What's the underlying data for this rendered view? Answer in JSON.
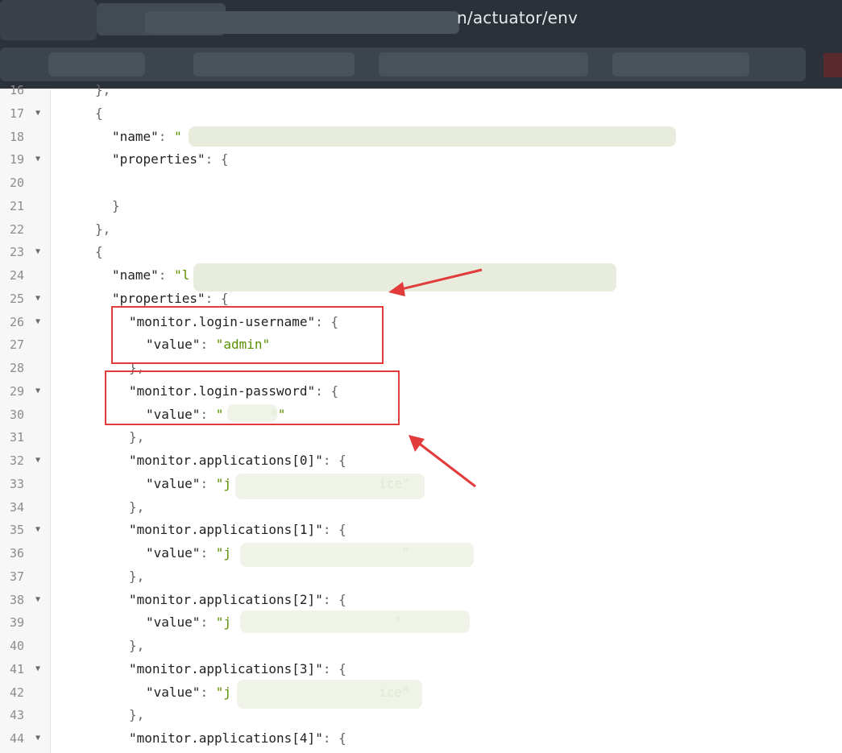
{
  "browser": {
    "url_visible": "n/actuator/env"
  },
  "editor": {
    "lines": [
      {
        "n": "16",
        "fold": false,
        "indent": 1,
        "parts": [
          {
            "t": "p",
            "v": "},"
          }
        ]
      },
      {
        "n": "17",
        "fold": true,
        "indent": 1,
        "parts": [
          {
            "t": "p",
            "v": "{"
          }
        ]
      },
      {
        "n": "18",
        "fold": false,
        "indent": 2,
        "parts": [
          {
            "t": "k",
            "v": "\"name\""
          },
          {
            "t": "p",
            "v": ": "
          },
          {
            "t": "s",
            "v": "\""
          }
        ]
      },
      {
        "n": "19",
        "fold": true,
        "indent": 2,
        "parts": [
          {
            "t": "k",
            "v": "\"properties\""
          },
          {
            "t": "p",
            "v": ": {"
          }
        ]
      },
      {
        "n": "20",
        "fold": false,
        "indent": 2,
        "parts": []
      },
      {
        "n": "21",
        "fold": false,
        "indent": 2,
        "parts": [
          {
            "t": "p",
            "v": "}"
          }
        ]
      },
      {
        "n": "22",
        "fold": false,
        "indent": 1,
        "parts": [
          {
            "t": "p",
            "v": "},"
          }
        ]
      },
      {
        "n": "23",
        "fold": true,
        "indent": 1,
        "parts": [
          {
            "t": "p",
            "v": "{"
          }
        ]
      },
      {
        "n": "24",
        "fold": false,
        "indent": 2,
        "parts": [
          {
            "t": "k",
            "v": "\"name\""
          },
          {
            "t": "p",
            "v": ": "
          },
          {
            "t": "s",
            "v": "\"l"
          }
        ]
      },
      {
        "n": "25",
        "fold": true,
        "indent": 2,
        "parts": [
          {
            "t": "k",
            "v": "\"properties\""
          },
          {
            "t": "p",
            "v": ": {"
          }
        ]
      },
      {
        "n": "26",
        "fold": true,
        "indent": 3,
        "parts": [
          {
            "t": "k",
            "v": "\"monitor.login-username\""
          },
          {
            "t": "p",
            "v": ": {"
          }
        ]
      },
      {
        "n": "27",
        "fold": false,
        "indent": 4,
        "parts": [
          {
            "t": "k",
            "v": "\"value\""
          },
          {
            "t": "p",
            "v": ": "
          },
          {
            "t": "s",
            "v": "\"admin\""
          }
        ]
      },
      {
        "n": "28",
        "fold": false,
        "indent": 3,
        "parts": [
          {
            "t": "p",
            "v": "},"
          }
        ]
      },
      {
        "n": "29",
        "fold": true,
        "indent": 3,
        "parts": [
          {
            "t": "k",
            "v": "\"monitor.login-password\""
          },
          {
            "t": "p",
            "v": ": {"
          }
        ]
      },
      {
        "n": "30",
        "fold": false,
        "indent": 4,
        "parts": [
          {
            "t": "k",
            "v": "\"value\""
          },
          {
            "t": "p",
            "v": ": "
          },
          {
            "t": "s",
            "v": "\"      *\""
          }
        ]
      },
      {
        "n": "31",
        "fold": false,
        "indent": 3,
        "parts": [
          {
            "t": "p",
            "v": "},"
          }
        ]
      },
      {
        "n": "32",
        "fold": true,
        "indent": 3,
        "parts": [
          {
            "t": "k",
            "v": "\"monitor.applications[0]\""
          },
          {
            "t": "p",
            "v": ": {"
          }
        ]
      },
      {
        "n": "33",
        "fold": false,
        "indent": 4,
        "parts": [
          {
            "t": "k",
            "v": "\"value\""
          },
          {
            "t": "p",
            "v": ": "
          },
          {
            "t": "s",
            "v": "\"j                   ice\""
          }
        ]
      },
      {
        "n": "34",
        "fold": false,
        "indent": 3,
        "parts": [
          {
            "t": "p",
            "v": "},"
          }
        ]
      },
      {
        "n": "35",
        "fold": true,
        "indent": 3,
        "parts": [
          {
            "t": "k",
            "v": "\"monitor.applications[1]\""
          },
          {
            "t": "p",
            "v": ": {"
          }
        ]
      },
      {
        "n": "36",
        "fold": false,
        "indent": 4,
        "parts": [
          {
            "t": "k",
            "v": "\"value\""
          },
          {
            "t": "p",
            "v": ": "
          },
          {
            "t": "s",
            "v": "\"j                      \""
          }
        ]
      },
      {
        "n": "37",
        "fold": false,
        "indent": 3,
        "parts": [
          {
            "t": "p",
            "v": "},"
          }
        ]
      },
      {
        "n": "38",
        "fold": true,
        "indent": 3,
        "parts": [
          {
            "t": "k",
            "v": "\"monitor.applications[2]\""
          },
          {
            "t": "p",
            "v": ": {"
          }
        ]
      },
      {
        "n": "39",
        "fold": false,
        "indent": 4,
        "parts": [
          {
            "t": "k",
            "v": "\"value\""
          },
          {
            "t": "p",
            "v": ": "
          },
          {
            "t": "s",
            "v": "\"j                     \""
          }
        ]
      },
      {
        "n": "40",
        "fold": false,
        "indent": 3,
        "parts": [
          {
            "t": "p",
            "v": "},"
          }
        ]
      },
      {
        "n": "41",
        "fold": true,
        "indent": 3,
        "parts": [
          {
            "t": "k",
            "v": "\"monitor.applications[3]\""
          },
          {
            "t": "p",
            "v": ": {"
          }
        ]
      },
      {
        "n": "42",
        "fold": false,
        "indent": 4,
        "parts": [
          {
            "t": "k",
            "v": "\"value\""
          },
          {
            "t": "p",
            "v": ": "
          },
          {
            "t": "s",
            "v": "\"j                   ice\""
          }
        ]
      },
      {
        "n": "43",
        "fold": false,
        "indent": 3,
        "parts": [
          {
            "t": "p",
            "v": "},"
          }
        ]
      },
      {
        "n": "44",
        "fold": true,
        "indent": 3,
        "parts": [
          {
            "t": "k",
            "v": "\"monitor.applications[4]\""
          },
          {
            "t": "p",
            "v": ": {"
          }
        ]
      }
    ]
  },
  "colors": {
    "annotation_red": "#e23b3b",
    "json_string": "#5a8f00",
    "chrome_bg": "#2b3138"
  },
  "icons": {
    "fold_marker": "fold-triangle-icon"
  }
}
